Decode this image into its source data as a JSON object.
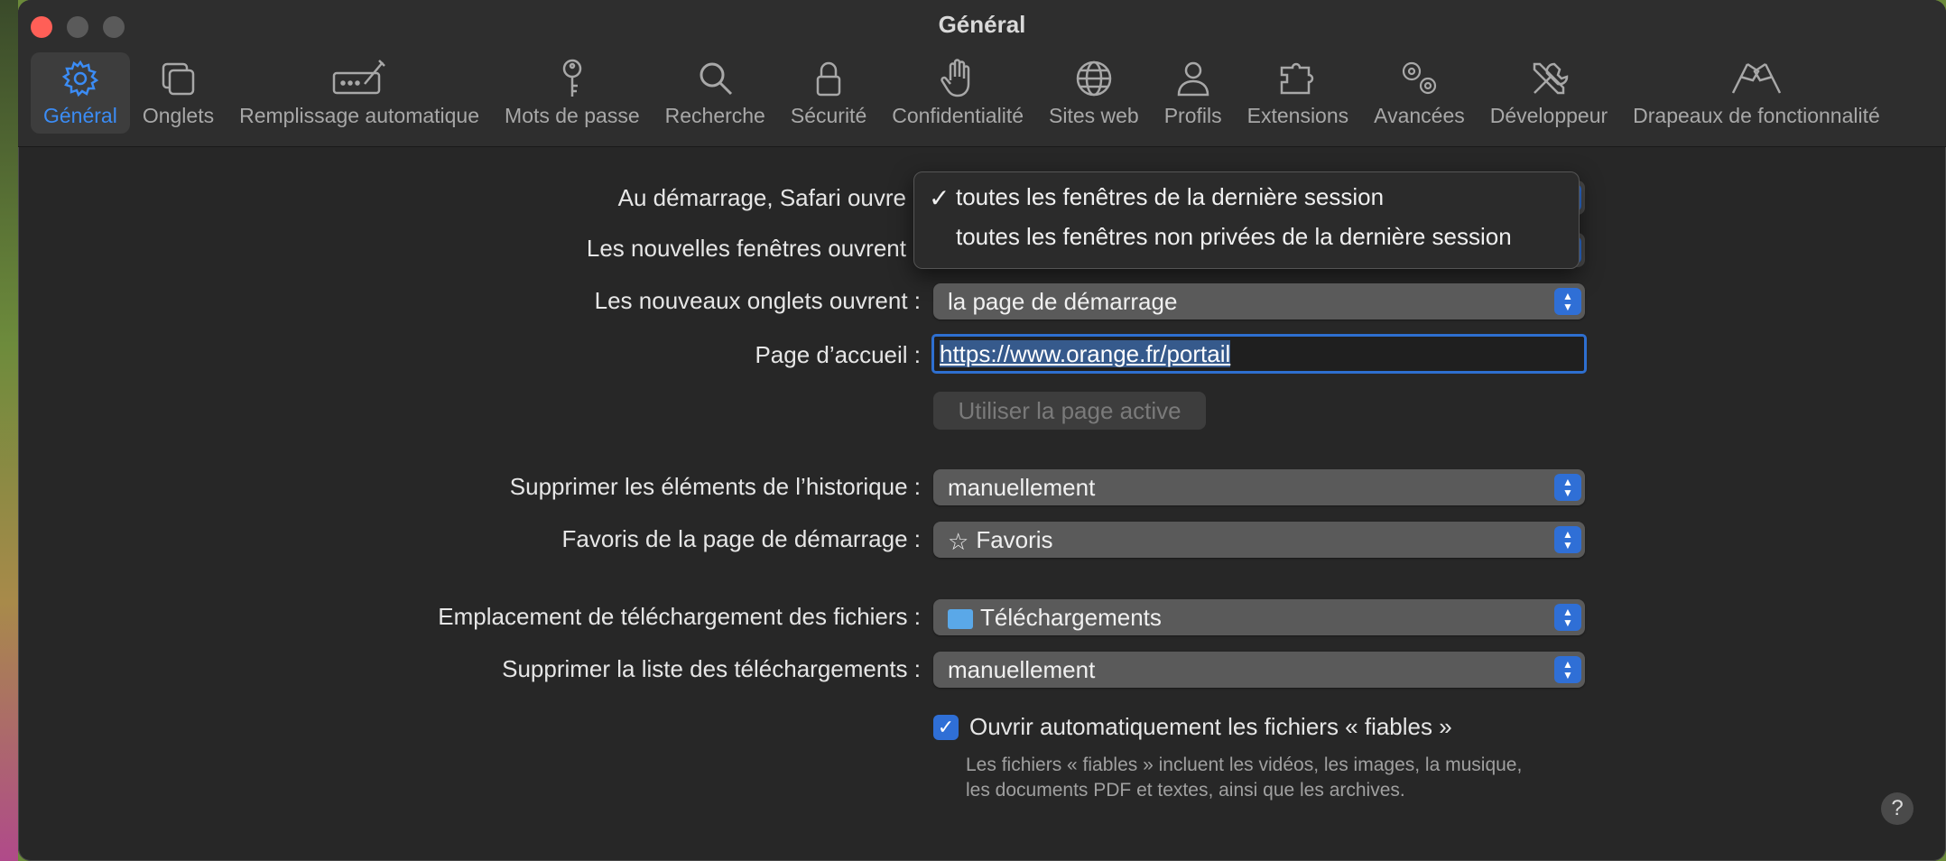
{
  "window": {
    "title": "Général"
  },
  "toolbar": {
    "items": [
      {
        "label": "Général",
        "icon": "gear-icon",
        "active": true
      },
      {
        "label": "Onglets",
        "icon": "tabs-icon"
      },
      {
        "label": "Remplissage automatique",
        "icon": "autofill-icon"
      },
      {
        "label": "Mots de passe",
        "icon": "key-icon"
      },
      {
        "label": "Recherche",
        "icon": "search-icon"
      },
      {
        "label": "Sécurité",
        "icon": "lock-icon"
      },
      {
        "label": "Confidentialité",
        "icon": "hand-icon"
      },
      {
        "label": "Sites web",
        "icon": "globe-icon"
      },
      {
        "label": "Profils",
        "icon": "person-icon"
      },
      {
        "label": "Extensions",
        "icon": "puzzle-icon"
      },
      {
        "label": "Avancées",
        "icon": "gears-icon"
      },
      {
        "label": "Développeur",
        "icon": "tools-icon"
      },
      {
        "label": "Drapeaux de fonctionnalité",
        "icon": "flags-icon"
      }
    ]
  },
  "settings": {
    "startup_label": "Au démarrage, Safari ouvre",
    "new_windows_label": "Les nouvelles fenêtres ouvrent",
    "new_tabs_label": "Les nouveaux onglets ouvrent :",
    "new_tabs_value": "la page de démarrage",
    "homepage_label": "Page d’accueil :",
    "homepage_value": "https://www.orange.fr/portail",
    "use_current_page_button": "Utiliser la page active",
    "remove_history_label": "Supprimer les éléments de l’historique :",
    "remove_history_value": "manuellement",
    "favorites_label": "Favoris de la page de démarrage :",
    "favorites_value": "Favoris",
    "download_location_label": "Emplacement de téléchargement des fichiers :",
    "download_location_value": "Téléchargements",
    "remove_downloads_label": "Supprimer la liste des téléchargements :",
    "remove_downloads_value": "manuellement",
    "open_safe_files_label": "Ouvrir automatiquement les fichiers « fiables »",
    "open_safe_files_checked": true,
    "open_safe_files_help": "Les fichiers « fiables » incluent les vidéos, les images, la musique, les documents PDF et textes, ainsi que les archives."
  },
  "startup_menu": {
    "options": [
      {
        "label": "toutes les fenêtres de la dernière session",
        "selected": true
      },
      {
        "label": "toutes les fenêtres non privées de la dernière session",
        "selected": false
      }
    ]
  },
  "help": {
    "label": "?"
  },
  "colors": {
    "accent": "#2f6fd6",
    "window_bg": "#272727",
    "close": "#ff5f57"
  }
}
